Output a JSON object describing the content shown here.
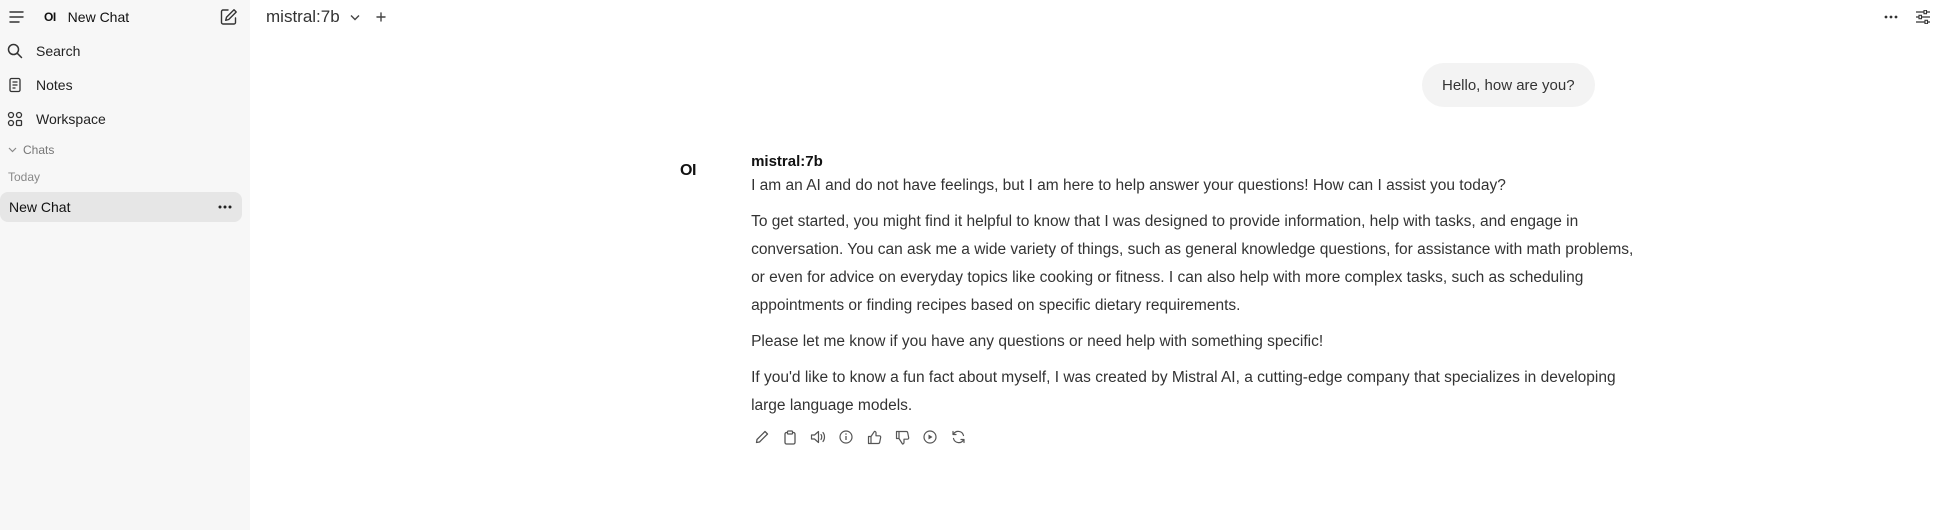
{
  "sidebar": {
    "logo": "OI",
    "title": "New Chat",
    "items": [
      {
        "label": "Search",
        "icon": "search-icon"
      },
      {
        "label": "Notes",
        "icon": "notes-icon"
      },
      {
        "label": "Workspace",
        "icon": "workspace-icon"
      }
    ],
    "section_label": "Chats",
    "group_label": "Today",
    "chats": [
      {
        "title": "New Chat"
      }
    ]
  },
  "header": {
    "model": "mistral:7b"
  },
  "conversation": {
    "user_message": "Hello, how are you?",
    "assistant": {
      "avatar": "OI",
      "model": "mistral:7b",
      "paragraphs": [
        "I am an AI and do not have feelings, but I am here to help answer your questions! How can I assist you today?",
        "To get started, you might find it helpful to know that I was designed to provide information, help with tasks, and engage in conversation. You can ask me a wide variety of things, such as general knowledge questions, for assistance with math problems, or even for advice on everyday topics like cooking or fitness. I can also help with more complex tasks, such as scheduling appointments or finding recipes based on specific dietary requirements.",
        "Please let me know if you have any questions or need help with something specific!",
        "If you'd like to know a fun fact about myself, I was created by Mistral AI, a cutting-edge company that specializes in developing large language models."
      ]
    },
    "action_icons": [
      "edit-icon",
      "copy-icon",
      "speaker-icon",
      "info-icon",
      "thumbs-up-icon",
      "thumbs-down-icon",
      "play-icon",
      "regenerate-icon"
    ]
  }
}
